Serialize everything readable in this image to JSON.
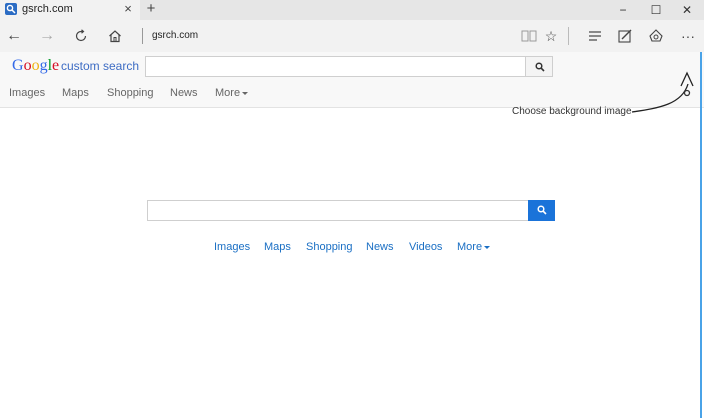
{
  "tab": {
    "title": "gsrch.com",
    "close": "×",
    "new_tab": "+"
  },
  "window": {
    "minimize": "−",
    "maximize": "☐",
    "close": "✕"
  },
  "address": {
    "url": "gsrch.com"
  },
  "header": {
    "logo": {
      "g1": "G",
      "o1": "o",
      "o2": "o",
      "g2": "g",
      "l": "l",
      "e": "e"
    },
    "label": "custom search",
    "search_placeholder": "",
    "nav": [
      "Images",
      "Maps",
      "Shopping",
      "News",
      "More"
    ]
  },
  "annotation": {
    "text": "Choose background image"
  },
  "main": {
    "search_placeholder": "",
    "nav": [
      "Images",
      "Maps",
      "Shopping",
      "News",
      "Videos",
      "More"
    ]
  },
  "icons": {
    "back": "back-arrow-icon",
    "forward": "forward-arrow-icon",
    "refresh": "refresh-icon",
    "home": "home-icon",
    "reading": "reading-view-icon",
    "favorite": "star-icon",
    "hub": "hub-icon",
    "note": "web-note-icon",
    "share": "share-icon",
    "more": "more-icon",
    "search": "search-icon"
  },
  "colors": {
    "accent": "#1a73d9",
    "link": "#1a6fc4",
    "edge": "#4aa3e8"
  }
}
